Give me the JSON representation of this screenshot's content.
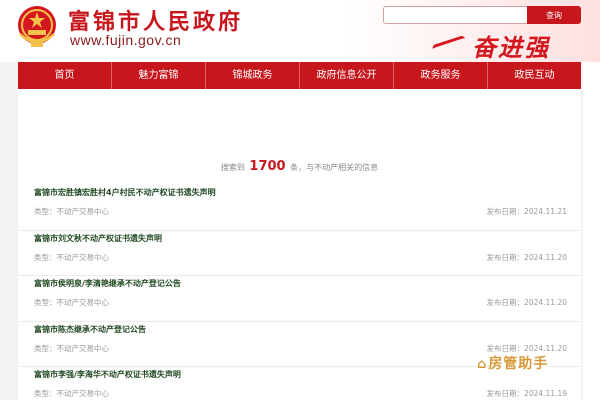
{
  "header": {
    "site_title": "富锦市人民政府",
    "site_url": "www.fujin.gov.cn",
    "slogan": "奋进强",
    "search_placeholder": "",
    "search_button": "查询"
  },
  "nav": {
    "items": [
      {
        "label": "首页"
      },
      {
        "label": "魅力富锦"
      },
      {
        "label": "锦城政务"
      },
      {
        "label": "政府信息公开"
      },
      {
        "label": "政务服务"
      },
      {
        "label": "政民互动"
      }
    ]
  },
  "summary": {
    "prefix": "搜索到",
    "count": "1700",
    "suffix": "条，与不动产相关的信息"
  },
  "results": [
    {
      "title": "富锦市宏胜镇宏胜村4户村民不动产权证书遗失声明",
      "type": "类型：不动产交易中心",
      "date": "发布日期：2024.11.21"
    },
    {
      "title": "富锦市刘文秋不动产权证书遗失声明",
      "type": "类型：不动产交易中心",
      "date": "发布日期：2024.11.20"
    },
    {
      "title": "富锦市侯明泉/李清艳继承不动产登记公告",
      "type": "类型：不动产交易中心",
      "date": "发布日期：2024.11.20"
    },
    {
      "title": "富锦市陈杰继承不动产登记公告",
      "type": "类型：不动产交易中心",
      "date": "发布日期：2024.11.20"
    },
    {
      "title": "富锦市李强/李海华不动产权证书遗失声明",
      "type": "类型：不动产交易中心",
      "date": "发布日期：2024.11.19"
    }
  ],
  "watermark": {
    "text": "房管助手"
  },
  "colors": {
    "brand_red": "#c8161d",
    "title_green": "#224a22"
  }
}
